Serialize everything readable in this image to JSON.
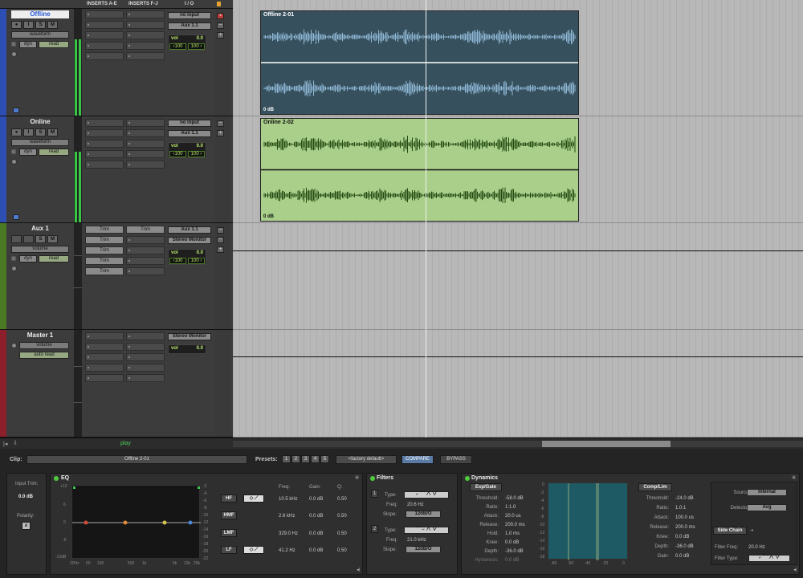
{
  "header": {
    "col_inserts_ae": "INSERTS A-E",
    "col_inserts_fj": "INSERTS F-J",
    "col_io": "I / O"
  },
  "tracks": [
    {
      "name": "Offline",
      "view": "waveform",
      "dyn": "dyn",
      "auto": "read",
      "input": "no input",
      "output": "Aux 1.1",
      "vol_label": "vol",
      "vol": "0.0",
      "pan_l": "‹100",
      "pan_r": "100 ›",
      "color": "#2d4fb3"
    },
    {
      "name": "Online",
      "view": "waveform",
      "dyn": "dyn",
      "auto": "read",
      "input": "no input",
      "output": "Aux 1.1",
      "vol_label": "vol",
      "vol": "0.0",
      "pan_l": "‹100",
      "pan_r": "100 ›",
      "color": "#2d4fb3"
    },
    {
      "name": "Aux 1",
      "view": "volume",
      "dyn": "dyn",
      "auto": "read",
      "input": "Aux 1.1",
      "output": "Stereo Monitor",
      "vol_label": "vol",
      "vol": "0.0",
      "pan_l": "‹100",
      "pan_r": "100 ›",
      "color": "#5c8a2e",
      "inserts_ae": [
        "Trim",
        "Trim",
        "Trim",
        "Trim",
        "Trim"
      ],
      "inserts_fj": [
        "Trim"
      ]
    },
    {
      "name": "Master 1",
      "view": "volume",
      "auto": "auto read",
      "output": "Stereo Monitor",
      "vol_label": "vol",
      "vol": "0.0",
      "color": "#8c1f2a"
    }
  ],
  "clips": [
    {
      "name": "Offline 2-01",
      "gain": "0 dB"
    },
    {
      "name": "Online 2-02",
      "gain": "0 dB"
    }
  ],
  "status": {
    "transport": "play"
  },
  "clip_bar": {
    "label": "Clip:",
    "clip_name": "Offline 2-01",
    "presets_label": "Presets:",
    "presets": [
      "1",
      "2",
      "3",
      "4",
      "5"
    ],
    "preset_name": "<factory default>",
    "compare": "COMPARE",
    "bypass": "BYPASS"
  },
  "input": {
    "trim_label": "Input Trim:",
    "trim_value": "0.0 dB",
    "polarity_label": "Polarity:",
    "polarity_symbol": "ø"
  },
  "eq": {
    "title": "EQ",
    "y_ticks": [
      "+12",
      "6",
      "0",
      "-6",
      "-12dB"
    ],
    "y_ticks_right": [
      "-2",
      "-4",
      "-6",
      "-8",
      "-10",
      "-12",
      "-14",
      "-16",
      "-18",
      "-20",
      "-22"
    ],
    "x_ticks": [
      "20Hz",
      "50",
      "100",
      "500",
      "1k",
      "5k",
      "10k",
      "20k"
    ],
    "col_freq": "Freq:",
    "col_gain": "Gain:",
    "col_q": "Q:",
    "bands": [
      {
        "name": "HF",
        "freq": "10.5 kHz",
        "gain": "0.0 dB",
        "q": "0.50"
      },
      {
        "name": "HMF",
        "freq": "2.6 kHz",
        "gain": "0.0 dB",
        "q": "0.50"
      },
      {
        "name": "LMF",
        "freq": "329.0 Hz",
        "gain": "0.0 dB",
        "q": "0.50"
      },
      {
        "name": "LF",
        "freq": "41.2 Hz",
        "gain": "0.0 dB",
        "q": "0.50"
      }
    ]
  },
  "filters": {
    "title": "Filters",
    "f1": {
      "num": "1",
      "type_label": "Type:",
      "freq_label": "Freq:",
      "freq": "20.6 Hz",
      "slope_label": "Slope:",
      "slope": "12dB/O"
    },
    "f2": {
      "num": "2",
      "type_label": "Type:",
      "freq_label": "Freq:",
      "freq": "21.0 kHz",
      "slope_label": "Slope:",
      "slope": "12dB/O"
    }
  },
  "dynamics": {
    "title": "Dynamics",
    "expgate": {
      "title": "Exp/Gate",
      "rows": [
        {
          "k": "Threshold:",
          "v": "-58.0 dB"
        },
        {
          "k": "Ratio:",
          "v": "1:1.0"
        },
        {
          "k": "Attack:",
          "v": "20.0 us"
        },
        {
          "k": "Release:",
          "v": "200.0 ms"
        },
        {
          "k": "Hold:",
          "v": "1.0 ms"
        },
        {
          "k": "Knee:",
          "v": "0.0 dB"
        },
        {
          "k": "Depth:",
          "v": "-36.0 dB"
        },
        {
          "k": "Hysteresis:",
          "v": "0.0 dB"
        }
      ]
    },
    "graph_y": [
      "0",
      "-2",
      "-4",
      "-6",
      "-8",
      "-10",
      "-12",
      "-14",
      "-16",
      "-18"
    ],
    "graph_x": [
      "-80",
      "-60",
      "-40",
      "-20",
      "0"
    ],
    "complim": {
      "title": "Comp/Lim",
      "rows": [
        {
          "k": "Threshold:",
          "v": "-24.0 dB"
        },
        {
          "k": "Ratio:",
          "v": "1.0:1"
        },
        {
          "k": "Attack:",
          "v": "100.0 us"
        },
        {
          "k": "Release:",
          "v": "200.0 ms"
        },
        {
          "k": "Knee:",
          "v": "0.0 dB"
        },
        {
          "k": "Depth:",
          "v": "-36.0 dB"
        },
        {
          "k": "Gain:",
          "v": "0.0 dB"
        }
      ]
    },
    "source_label": "Source:",
    "source": "Internal",
    "detector_label": "Detector:",
    "detector": "Avg",
    "side_chain": "Side Chain",
    "filter_freq_label": "Filter Freq:",
    "filter_freq": "20.0 Hz",
    "filter_type_label": "Filter Type:"
  }
}
